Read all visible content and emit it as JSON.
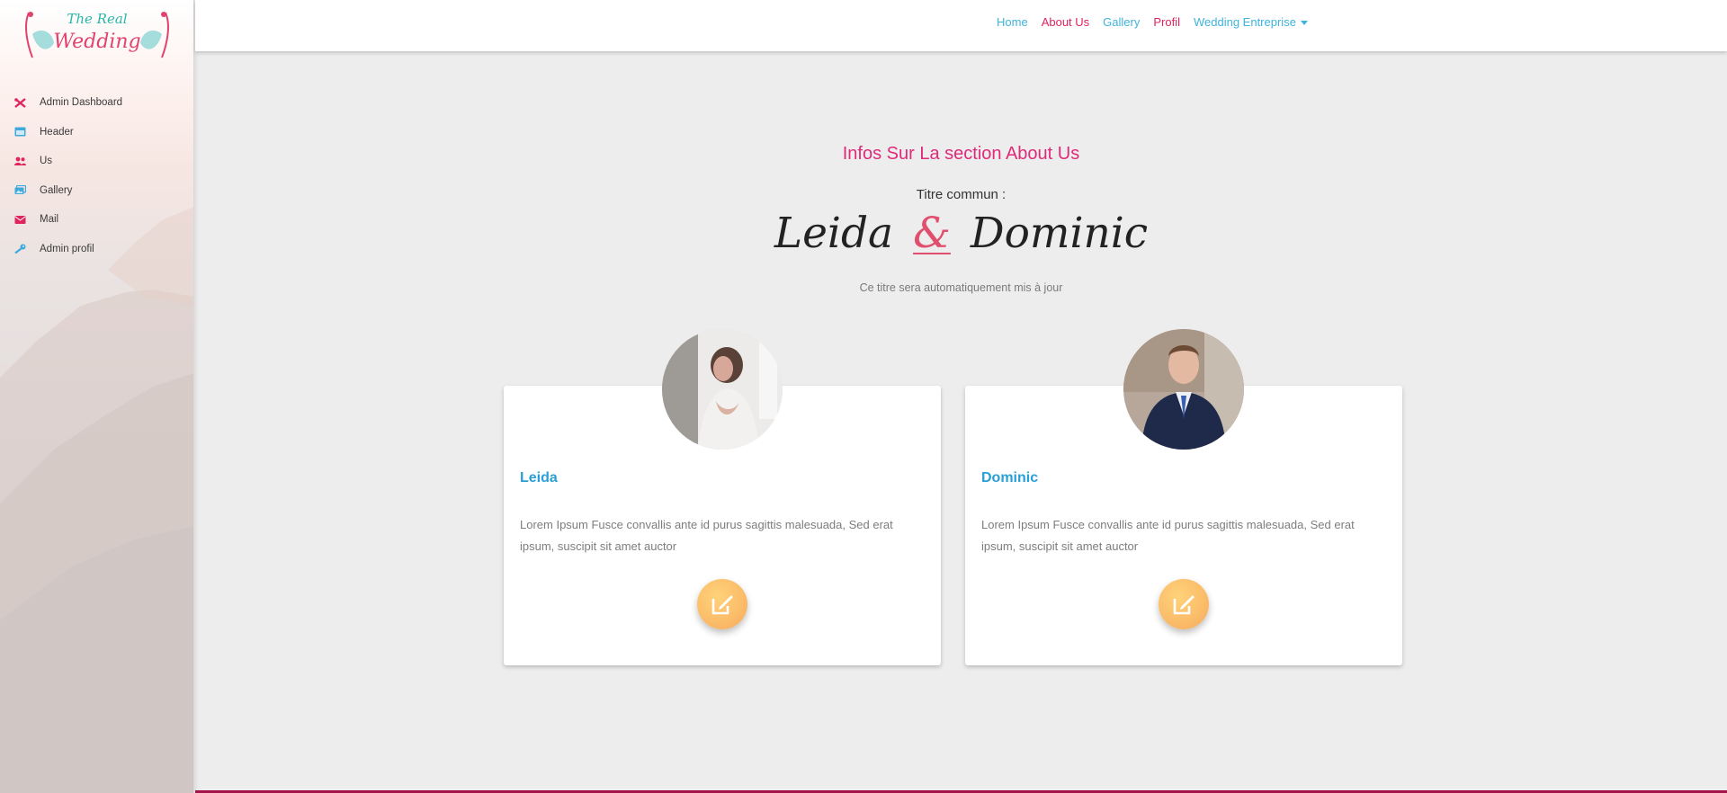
{
  "sidebar": {
    "logo": {
      "line1": "The Real",
      "line2": "Wedding"
    },
    "items": [
      {
        "label": "Admin Dashboard",
        "icon": "tools-icon",
        "color": "#e0245e"
      },
      {
        "label": "Header",
        "icon": "window-icon",
        "color": "#3fa9dc"
      },
      {
        "label": "Us",
        "icon": "users-icon",
        "color": "#e0245e"
      },
      {
        "label": "Gallery",
        "icon": "images-icon",
        "color": "#3fa9dc"
      },
      {
        "label": "Mail",
        "icon": "envelope-icon",
        "color": "#e0245e"
      },
      {
        "label": "Admin profil",
        "icon": "key-icon",
        "color": "#3fa9dc"
      }
    ]
  },
  "topnav": {
    "items": [
      {
        "label": "Home",
        "color": "#3fb3dc"
      },
      {
        "label": "About Us",
        "color": "#e0245e"
      },
      {
        "label": "Gallery",
        "color": "#3fb3dc"
      },
      {
        "label": "Profil",
        "color": "#e0245e"
      },
      {
        "label": "Wedding Entreprise",
        "color": "#3fb3dc"
      }
    ]
  },
  "main": {
    "section_title": "Infos Sur La section About Us",
    "common_label": "Titre commun :",
    "couple": {
      "first": "Leida",
      "ampersand": "&",
      "second": "Dominic"
    },
    "note": "Ce titre sera automatiquement mis à jour",
    "cards": [
      {
        "name": "Leida",
        "text": "Lorem Ipsum Fusce convallis ante id purus sagittis malesuada, Sed erat ipsum, suscipit sit amet auctor",
        "photo": "bride-photo"
      },
      {
        "name": "Dominic",
        "text": "Lorem Ipsum Fusce convallis ante id purus sagittis malesuada, Sed erat ipsum, suscipit sit amet auctor",
        "photo": "groom-photo"
      }
    ]
  },
  "colors": {
    "accent_pink": "#e02a79",
    "accent_blue": "#2a9fd6",
    "edit_button": "#fbbe6a",
    "bottom_bar": "#a3154a"
  }
}
